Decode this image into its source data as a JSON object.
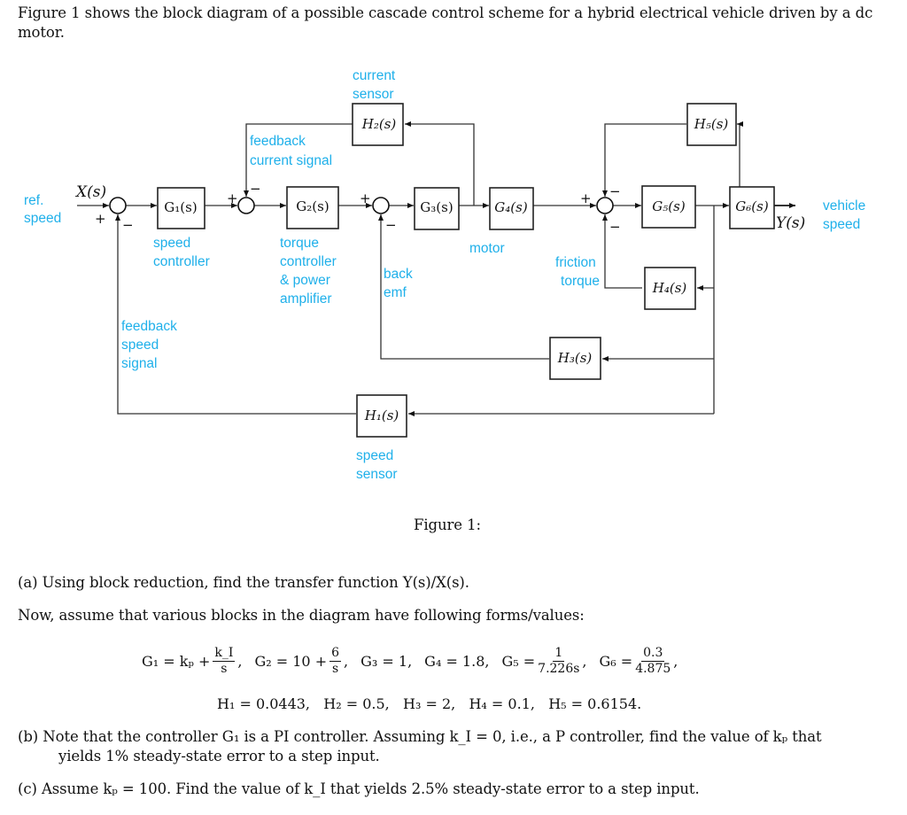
{
  "intro": "Figure 1 shows the block diagram of a possible cascade control scheme for a hybrid electrical vehicle driven by a dc motor.",
  "diagram": {
    "blocks": {
      "G1": "G₁(s)",
      "G2": "G₂(s)",
      "G3": "G₃(s)",
      "G4": "G₄(s)",
      "G5": "G₅(s)",
      "G6": "G₆(s)",
      "H1": "H₁(s)",
      "H2": "H₂(s)",
      "H3": "H₃(s)",
      "H4": "H₄(s)",
      "H5": "H₅(s)"
    },
    "input": "X(s)",
    "output": "Y(s)",
    "labels": {
      "ref_speed": [
        "ref.",
        "speed"
      ],
      "current_sensor": [
        "current",
        "sensor"
      ],
      "feedback_current": [
        "feedback",
        "current signal"
      ],
      "speed_controller": [
        "speed",
        "controller"
      ],
      "torque_controller": [
        "torque",
        "controller",
        "& power",
        "amplifier"
      ],
      "back_emf": [
        "back",
        "emf"
      ],
      "motor": "motor",
      "friction_torque": [
        "friction",
        "torque"
      ],
      "vehicle_speed": [
        "vehicle",
        "speed"
      ],
      "feedback_speed": [
        "feedback",
        "speed",
        "signal"
      ],
      "speed_sensor": [
        "speed",
        "sensor"
      ]
    },
    "signs": {
      "plus": "+",
      "minus": "−"
    },
    "colors": {
      "label": "#1fb0ea",
      "line": "#333333"
    }
  },
  "caption": "Figure 1:",
  "question_a": "(a) Using block reduction, find the transfer function Y(s)/X(s).",
  "assume_text": "Now, assume that various blocks in the diagram have following forms/values:",
  "values": {
    "G1": {
      "lhs": "G₁ = kₚ + ",
      "num": "k_I",
      "den": "s"
    },
    "G2": {
      "lhs": "G₂ = 10 + ",
      "num": "6",
      "den": "s"
    },
    "G3": "G₃ = 1,",
    "G4": "G₄ = 1.8,",
    "G5": {
      "lhs": "G₅ = ",
      "num": "1",
      "den": "7.226s"
    },
    "G6": {
      "lhs": "G₆ = ",
      "num": "0.3",
      "den": "4.875"
    },
    "H_row": "H₁ = 0.0443,   H₂ = 0.5,   H₃ = 2,   H₄ = 0.1,   H₅ = 0.6154."
  },
  "question_b": {
    "line1": "(b) Note that the controller G₁ is a PI controller. Assuming k_I = 0, i.e., a P controller, find the value of kₚ that",
    "line2": "yields 1% steady-state error to a step input."
  },
  "question_c": "(c) Assume kₚ = 100. Find the value of k_I that yields 2.5% steady-state error to a step input."
}
